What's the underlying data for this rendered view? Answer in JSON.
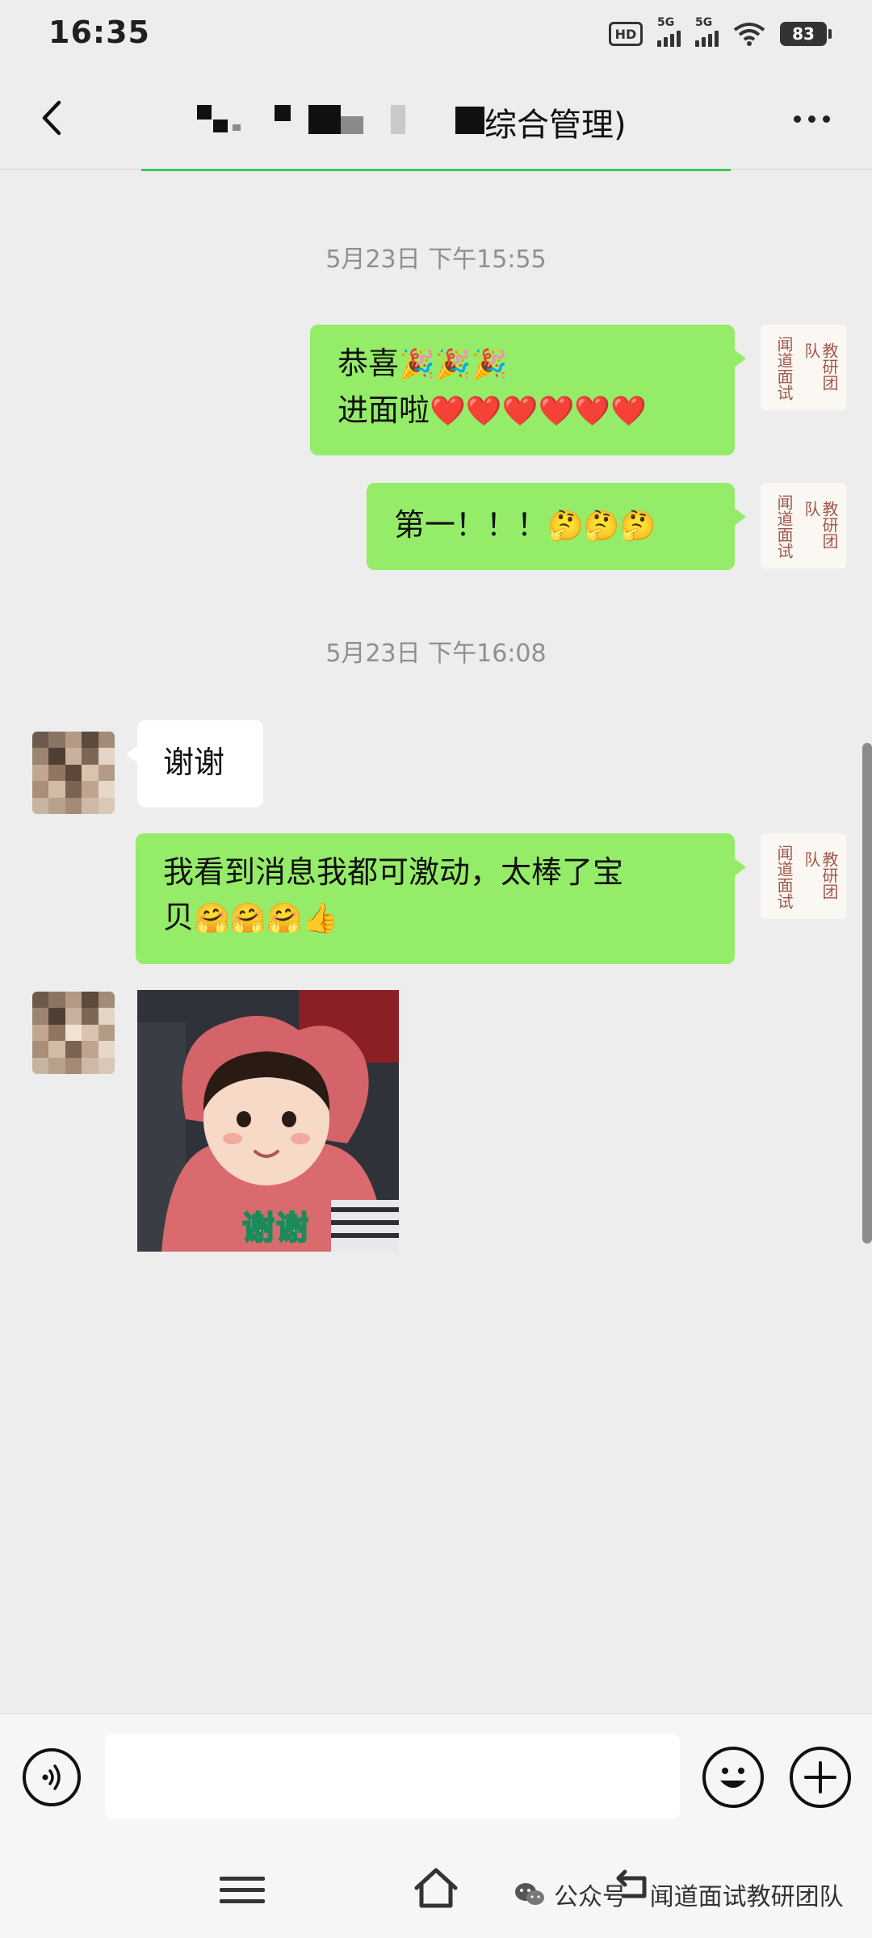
{
  "status_bar": {
    "time": "16:35",
    "hd_label": "HD",
    "network_1": "5G",
    "network_2": "5G",
    "battery": "83"
  },
  "header": {
    "title_suffix": "综合管理)",
    "back_icon": "chevron-left-icon",
    "more_icon": "more-dots-icon"
  },
  "messages": [
    {
      "type": "timestamp",
      "text": "5月23日 下午15:55"
    },
    {
      "type": "text",
      "sender": "me",
      "line1": "恭喜",
      "line1_emoji": "🎉🎉🎉",
      "line2": "进面啦",
      "line2_emoji": "❤️❤️❤️❤️❤️❤️"
    },
    {
      "type": "text",
      "sender": "me",
      "text": "第一！！！",
      "emoji": "🤔🤔🤔"
    },
    {
      "type": "timestamp",
      "text": "5月23日 下午16:08"
    },
    {
      "type": "text",
      "sender": "them",
      "text": "谢谢"
    },
    {
      "type": "text",
      "sender": "me",
      "line1": "我看到消息我都可激动，太棒了宝",
      "line2": "贝",
      "line2_emoji": "🤗🤗🤗👍"
    },
    {
      "type": "sticker",
      "sender": "them",
      "caption": "谢谢"
    }
  ],
  "my_avatar": {
    "col1": "闻道面试",
    "col2": "教研团队"
  },
  "input_bar": {
    "placeholder": "",
    "voice_icon": "voice-icon",
    "emoji_icon": "emoji-smile-icon",
    "plus_icon": "plus-circle-icon"
  },
  "nav_bar": {
    "menu_icon": "menu-icon",
    "home_icon": "home-icon",
    "back_icon": "back-icon"
  },
  "watermark": {
    "icon": "wechat-icon",
    "text": "公众号 · 闻道面试教研团队"
  },
  "colors": {
    "background": "#ededed",
    "my_bubble": "#95ec69",
    "their_bubble": "#ffffff",
    "timestamp": "#8f8f8f",
    "accent_green": "#3fc85a"
  }
}
